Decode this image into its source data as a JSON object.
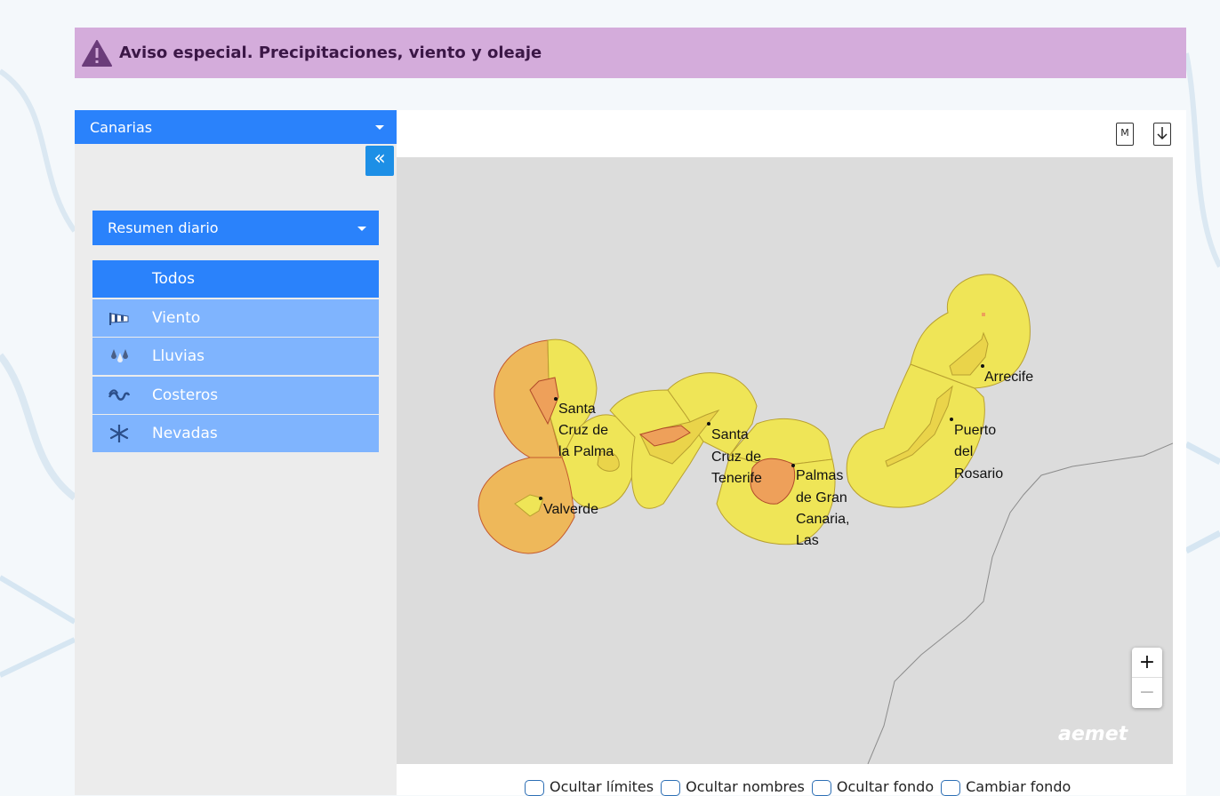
{
  "alert": {
    "title": "Aviso especial. Precipitaciones, viento y oleaje",
    "icon": "warning-icon",
    "bg": "#d4acdb"
  },
  "sidebar": {
    "region": "Canarias",
    "collapse_label": "«",
    "summary": "Resumen diario",
    "filters": [
      {
        "label": "Todos",
        "icon": "",
        "active": true
      },
      {
        "label": "Viento",
        "icon": "windsock-icon",
        "active": false
      },
      {
        "label": "Lluvias",
        "icon": "rain-icon",
        "active": false
      },
      {
        "label": "Costeros",
        "icon": "waves-icon",
        "active": false
      },
      {
        "label": "Nevadas",
        "icon": "snowflake-icon",
        "active": false
      }
    ]
  },
  "map": {
    "tools": {
      "m_label": "M"
    },
    "zoom": {
      "in": "+",
      "out": "−"
    },
    "logo": "aemet",
    "colors": {
      "yellow": "#efe557",
      "orange": "#eeb85a",
      "orange_island": "#eea05a"
    },
    "cities": [
      {
        "lines": [
          "Santa",
          "Cruz de",
          "la Palma"
        ]
      },
      {
        "lines": [
          "Valverde"
        ]
      },
      {
        "lines": [
          "Santa",
          "Cruz de",
          "Tenerife"
        ]
      },
      {
        "lines": [
          "Palmas",
          "de Gran",
          "Canaria,",
          "Las"
        ]
      },
      {
        "lines": [
          "Arrecife"
        ]
      },
      {
        "lines": [
          "Puerto",
          "del",
          "Rosario"
        ]
      }
    ]
  },
  "options": [
    {
      "label": "Ocultar límites"
    },
    {
      "label": "Ocultar nombres"
    },
    {
      "label": "Ocultar fondo"
    },
    {
      "label": "Cambiar fondo"
    }
  ]
}
